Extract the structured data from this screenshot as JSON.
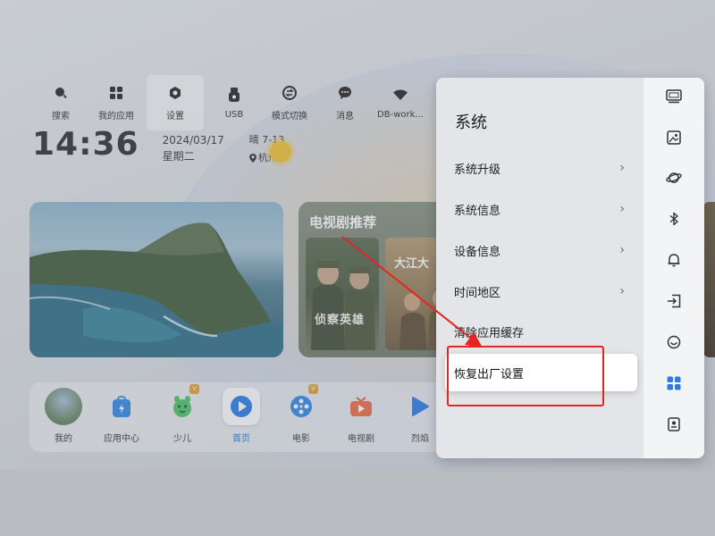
{
  "topnav": {
    "items": [
      {
        "label": "搜索",
        "icon": "search-icon"
      },
      {
        "label": "我的应用",
        "icon": "apps-grid-icon"
      },
      {
        "label": "设置",
        "icon": "settings-gear-icon"
      },
      {
        "label": "USB",
        "icon": "usb-icon"
      },
      {
        "label": "模式切换",
        "icon": "mode-switch-icon"
      },
      {
        "label": "消息",
        "icon": "message-icon"
      },
      {
        "label": "DB-work...",
        "icon": "wifi-icon"
      }
    ],
    "active_index": 2
  },
  "status": {
    "clock": "14:36",
    "date": "2024/03/17",
    "weekday": "星期二",
    "weather_range": "晴 7-13",
    "location": "杭州"
  },
  "drama_card": {
    "title": "电视剧推荐",
    "poster1_title": "侦察英雄",
    "poster2_title": "大江大"
  },
  "dock": {
    "items": [
      {
        "label": "我的",
        "icon": "avatar-icon"
      },
      {
        "label": "应用中心",
        "icon": "app-center-icon"
      },
      {
        "label": "少儿",
        "icon": "kids-icon"
      },
      {
        "label": "首页",
        "icon": "home-play-icon"
      },
      {
        "label": "电影",
        "icon": "film-reel-icon"
      },
      {
        "label": "电视剧",
        "icon": "tv-series-icon"
      },
      {
        "label": "烈焰",
        "icon": "play-icon"
      }
    ],
    "active_index": 3,
    "vip_badge": "V"
  },
  "settings_panel": {
    "title": "系统",
    "items": [
      {
        "label": "系统升级",
        "has_chevron": true
      },
      {
        "label": "系统信息",
        "has_chevron": true
      },
      {
        "label": "设备信息",
        "has_chevron": true
      },
      {
        "label": "时间地区",
        "has_chevron": true
      },
      {
        "label": "清除应用缓存",
        "has_chevron": false
      },
      {
        "label": "恢复出厂设置",
        "has_chevron": false
      }
    ],
    "focused_index": 5,
    "chevron": "›",
    "side_icons": [
      "display-icon",
      "picture-icon",
      "planet-icon",
      "bluetooth-icon",
      "bell-icon",
      "input-source-icon",
      "smile-icon",
      "system-grid-icon",
      "device-info-icon"
    ],
    "side_active_index": 7
  },
  "colors": {
    "accent_blue": "#1e73e8",
    "annotation_red": "#e52424"
  }
}
